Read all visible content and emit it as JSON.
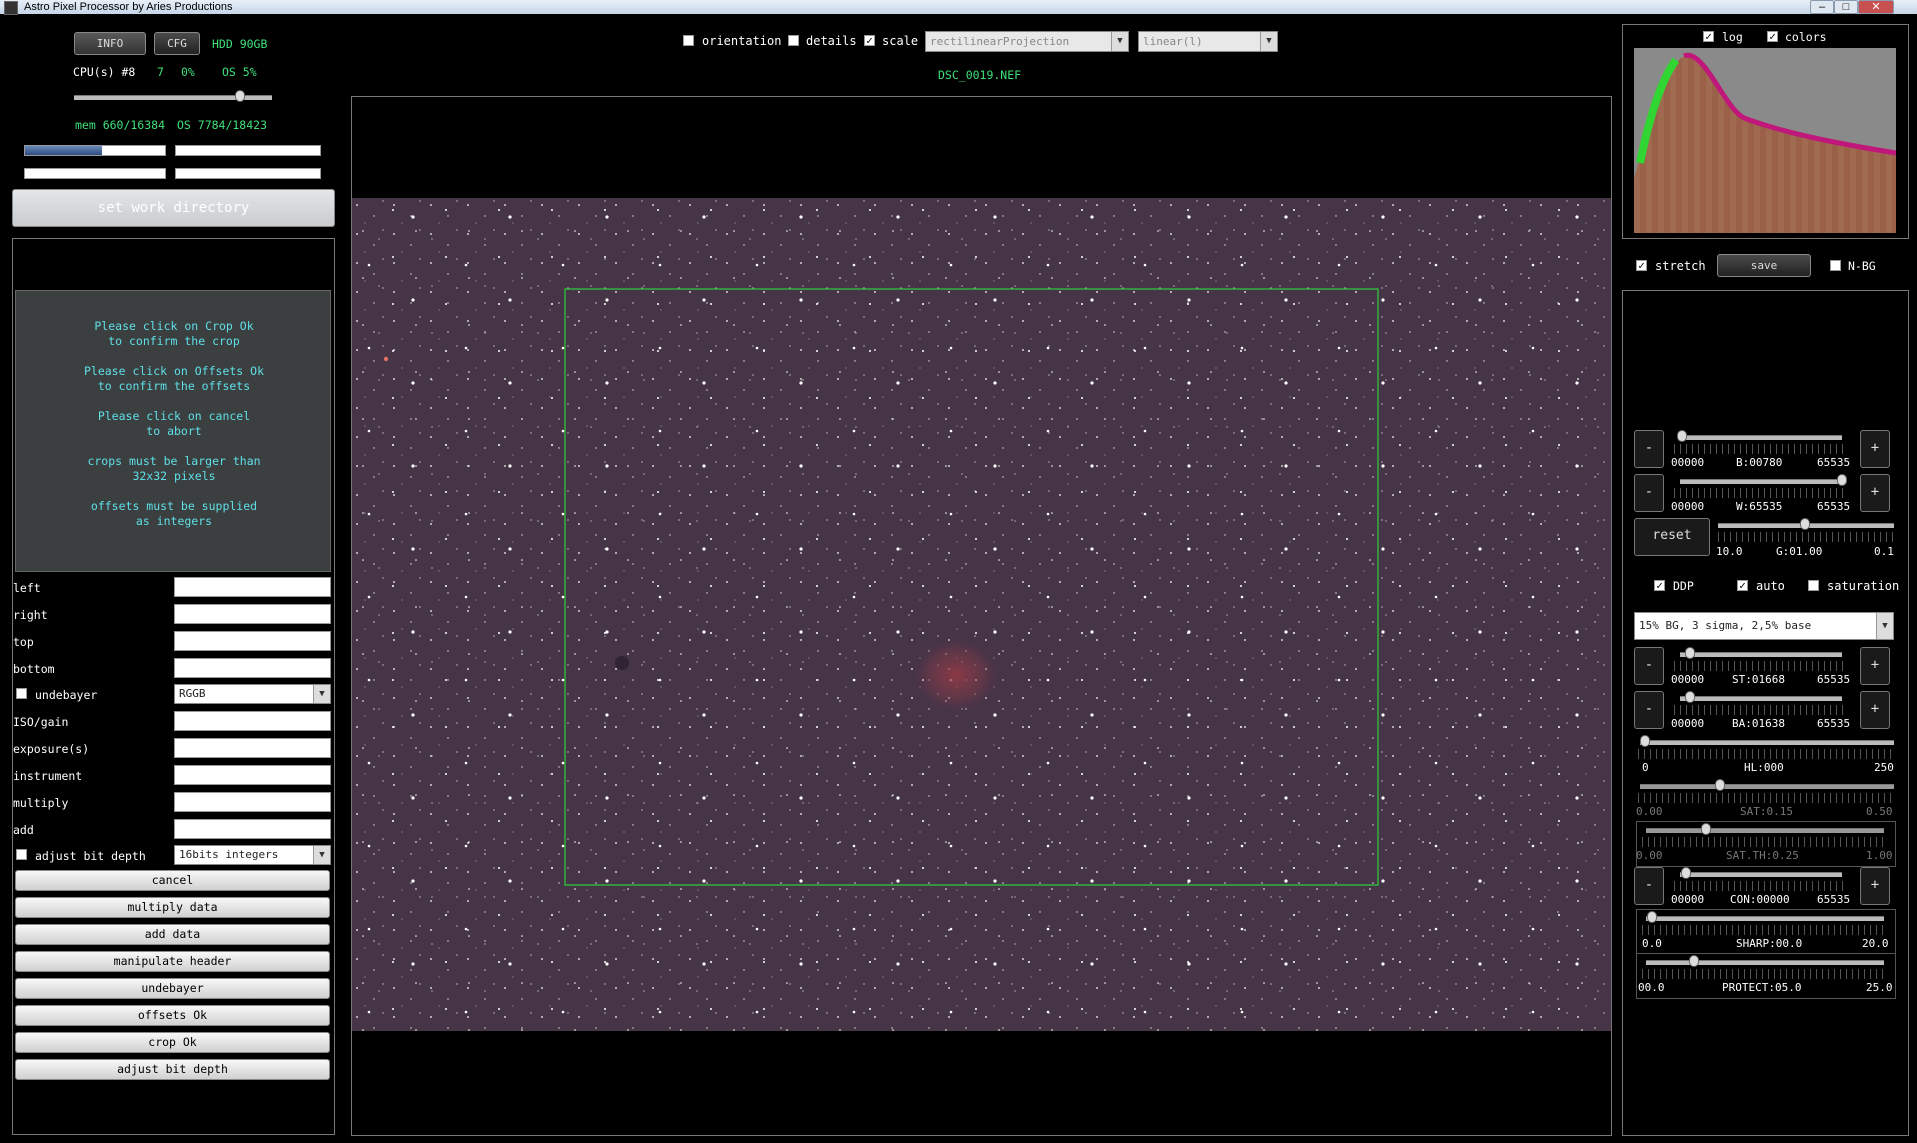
{
  "window": {
    "title": "Astro Pixel Processor by Aries Productions"
  },
  "top_left": {
    "info_label": "INFO",
    "cfg_label": "CFG",
    "hdd": "HDD 90GB",
    "cpu": "CPU(s) #8",
    "cpu_value": "7",
    "cpu_pct": "0%",
    "os_pct": "OS 5%",
    "mem": "mem 660/16384",
    "os_mem": "OS 7784/18423",
    "mem_fraction": 0.55,
    "set_work_directory": "set work directory"
  },
  "message_lines": [
    [
      "Please click on Crop Ok",
      "to confirm the crop"
    ],
    [
      "Please click on Offsets Ok",
      "to confirm the offsets"
    ],
    [
      "Please click on cancel",
      "to abort"
    ],
    [
      "crops must be larger than",
      "32x32 pixels"
    ],
    [
      "offsets must be supplied",
      "as integers"
    ]
  ],
  "form": {
    "left": "left",
    "right": "right",
    "top": "top",
    "bottom": "bottom",
    "undebayer": "undebayer",
    "undebayer_value": "RGGB",
    "iso": "ISO/gain",
    "exposure": "exposure(s)",
    "instrument": "instrument",
    "multiply": "multiply",
    "add": "add",
    "adjust_bit_depth": "adjust bit depth",
    "bit_depth_value": "16bits integers"
  },
  "buttons": [
    "cancel",
    "multiply data",
    "add data",
    "manipulate header",
    "undebayer",
    "offsets Ok",
    "crop Ok",
    "adjust bit depth"
  ],
  "toolbar": {
    "orientation": "orientation",
    "details": "details",
    "scale": "scale",
    "projection": "rectilinearProjection",
    "stretch_mode": "linear(l)",
    "filename": "DSC_0019.NEF"
  },
  "histogram": {
    "log": "log",
    "colors": "colors"
  },
  "right": {
    "stretch": "stretch",
    "save": "save",
    "nbg": "N-BG",
    "minus": "-",
    "plus": "+",
    "reset": "reset",
    "b": {
      "min": "00000",
      "label": "B:00780",
      "max": "65535",
      "value": 780,
      "range": 65535
    },
    "w": {
      "min": "00000",
      "label": "W:65535",
      "max": "65535",
      "value": 65535,
      "range": 65535
    },
    "g": {
      "min": "10.0",
      "label": "G:01.00",
      "max": "0.1"
    },
    "ddp": "DDP",
    "auto": "auto",
    "saturation": "saturation",
    "preset": "15% BG, 3 sigma, 2,5% base",
    "st": {
      "min": "00000",
      "label": "ST:01668",
      "max": "65535",
      "value": 1668,
      "range": 65535
    },
    "ba": {
      "min": "00000",
      "label": "BA:01638",
      "max": "65535",
      "value": 1638,
      "range": 65535
    },
    "hl": {
      "min": "0",
      "label": "HL:000",
      "max": "250",
      "value": 0,
      "range": 250
    },
    "sat": {
      "min": "0.00",
      "label": "SAT:0.15",
      "max": "0.50",
      "value": 0.15,
      "range": 0.5
    },
    "sat_th": {
      "min": "0.00",
      "label": "SAT.TH:0.25",
      "max": "1.00",
      "value": 0.25,
      "range": 1.0
    },
    "con": {
      "min": "00000",
      "label": "CON:00000",
      "max": "65535",
      "value": 0,
      "range": 65535
    },
    "sharp": {
      "min": "0.0",
      "label": "SHARP:00.0",
      "max": "20.0",
      "value": 0,
      "range": 20
    },
    "protect": {
      "min": "00.0",
      "label": "PROTECT:05.0",
      "max": "25.0",
      "value": 5,
      "range": 25
    }
  },
  "colors": {
    "accent_green": "#3ee07a",
    "cyan_text": "#5fe0e8",
    "crop_rect": "#2bd23a"
  }
}
